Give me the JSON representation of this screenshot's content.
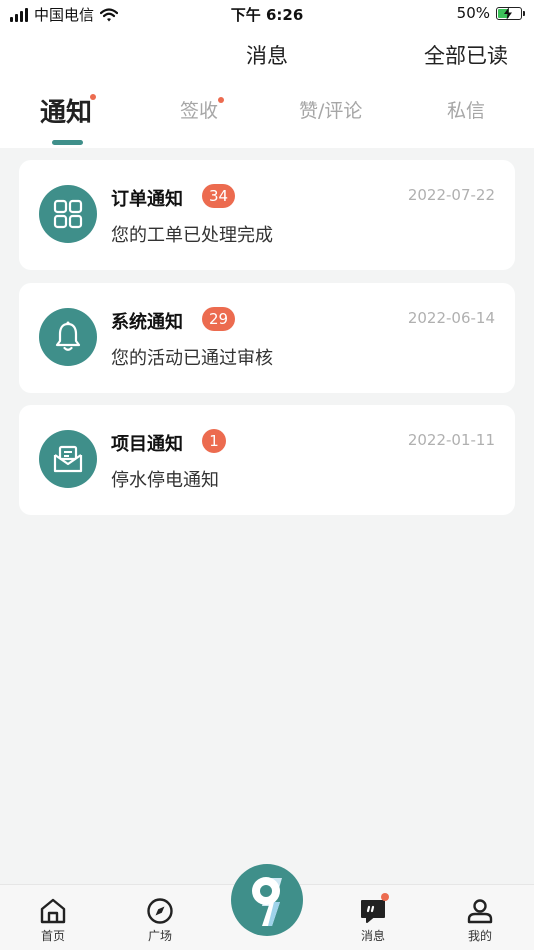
{
  "status_bar": {
    "carrier": "中国电信",
    "time": "下午 6:26",
    "battery": "50%"
  },
  "nav": {
    "title": "消息",
    "read_all": "全部已读"
  },
  "tabs": [
    {
      "label": "通知",
      "active": true,
      "has_dot": true
    },
    {
      "label": "签收",
      "active": false,
      "has_dot": true
    },
    {
      "label": "赞/评论",
      "active": false,
      "has_dot": false
    },
    {
      "label": "私信",
      "active": false,
      "has_dot": false
    }
  ],
  "notifications": [
    {
      "title": "订单通知",
      "badge": "34",
      "date": "2022-07-22",
      "desc": "您的工单已处理完成",
      "icon": "grid-icon"
    },
    {
      "title": "系统通知",
      "badge": "29",
      "date": "2022-06-14",
      "desc": "您的活动已通过审核",
      "icon": "bell-icon"
    },
    {
      "title": "项目通知",
      "badge": "1",
      "date": "2022-01-11",
      "desc": "停水停电通知",
      "icon": "envelope-icon"
    }
  ],
  "tabbar": {
    "home": "首页",
    "plaza": "广场",
    "messages": "消息",
    "mine": "我的"
  },
  "colors": {
    "accent": "#3f8f8a",
    "badge": "#ec6b4f",
    "date": "#b0b0b0",
    "background": "#f3f4f4"
  }
}
